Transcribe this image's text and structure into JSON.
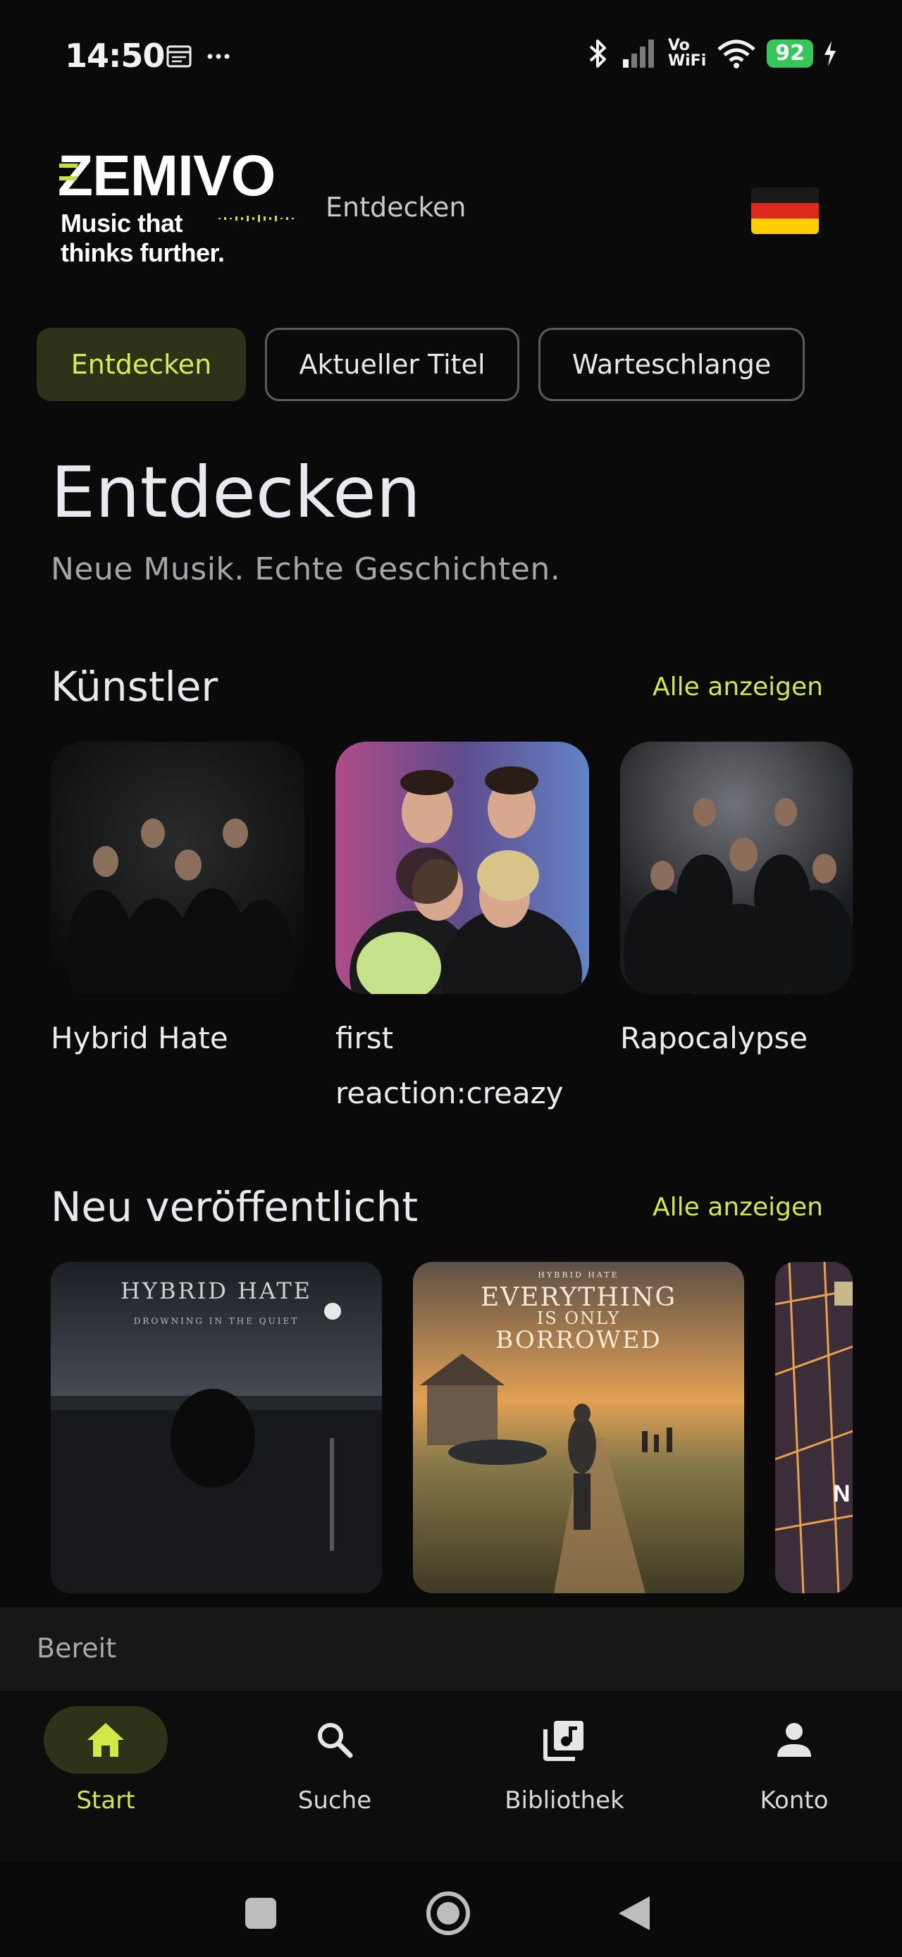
{
  "status_bar": {
    "time": "14:50",
    "battery": "92",
    "vo_line1": "Vo",
    "vo_line2": "WiFi"
  },
  "header": {
    "logo_text": "ZEMIVO",
    "slogan_line1": "Music that",
    "slogan_line2": "thinks further.",
    "current_section": "Entdecken",
    "language_flag": "germany-flag-icon"
  },
  "tabs": [
    {
      "label": "Entdecken",
      "active": true
    },
    {
      "label": "Aktueller Titel",
      "active": false
    },
    {
      "label": "Warteschlange",
      "active": false
    }
  ],
  "page": {
    "title": "Entdecken",
    "subtitle": "Neue Musik. Echte Geschichten."
  },
  "artists_section": {
    "title": "Künstler",
    "see_all": "Alle anzeigen",
    "items": [
      {
        "name": "Hybrid Hate"
      },
      {
        "name": "first reaction:creazy"
      },
      {
        "name": "Rapocalypse"
      }
    ]
  },
  "releases_section": {
    "title": "Neu veröffentlicht",
    "see_all": "Alle anzeigen",
    "items": [
      {
        "artist": "HYBRID HATE",
        "title": "DROWNING IN THE QUIET"
      },
      {
        "artist": "HYBRID HATE",
        "title_line1": "EVERYTHING",
        "title_line2": "IS ONLY",
        "title_line3": "BORROWED"
      },
      {
        "partial": "N"
      }
    ]
  },
  "player_status": "Bereit",
  "bottom_nav": [
    {
      "label": "Start",
      "icon": "home-icon",
      "active": true
    },
    {
      "label": "Suche",
      "icon": "search-icon",
      "active": false
    },
    {
      "label": "Bibliothek",
      "icon": "library-music-icon",
      "active": false
    },
    {
      "label": "Konto",
      "icon": "person-icon",
      "active": false
    }
  ],
  "colors": {
    "accent": "#d3e746",
    "background": "#090a09",
    "active_pill": "#2d3318"
  }
}
